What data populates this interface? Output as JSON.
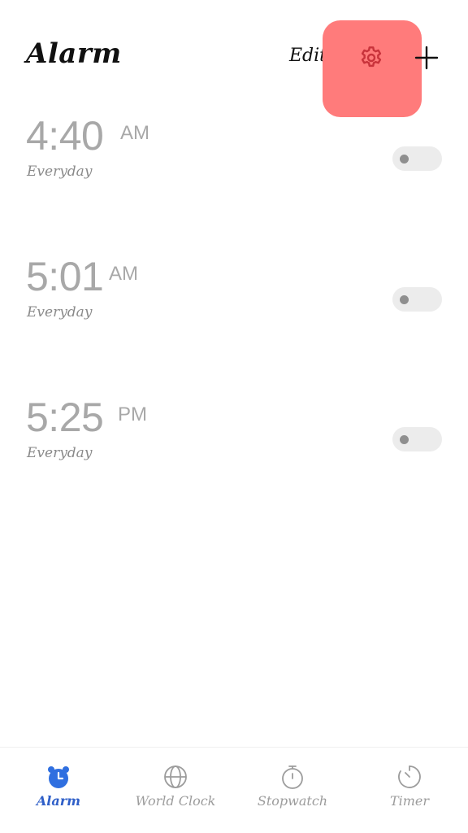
{
  "header": {
    "title": "Alarm",
    "edit_label": "Edit",
    "settings_icon": "gear-icon",
    "add_icon": "plus-icon",
    "highlight_color": "#ff7b7b"
  },
  "alarms": [
    {
      "time": "4:40",
      "period": "AM",
      "repeat": "Everyday",
      "enabled": false
    },
    {
      "time": "5:01",
      "period": "AM",
      "repeat": "Everyday",
      "enabled": false
    },
    {
      "time": "5:25",
      "period": "PM",
      "repeat": "Everyday",
      "enabled": false
    }
  ],
  "bottom_nav": {
    "active_color": "#2f5fc8",
    "items": [
      {
        "label": "Alarm",
        "icon": "alarm-clock-icon",
        "active": true
      },
      {
        "label": "World Clock",
        "icon": "globe-icon",
        "active": false
      },
      {
        "label": "Stopwatch",
        "icon": "stopwatch-icon",
        "active": false
      },
      {
        "label": "Timer",
        "icon": "timer-icon",
        "active": false
      }
    ]
  }
}
